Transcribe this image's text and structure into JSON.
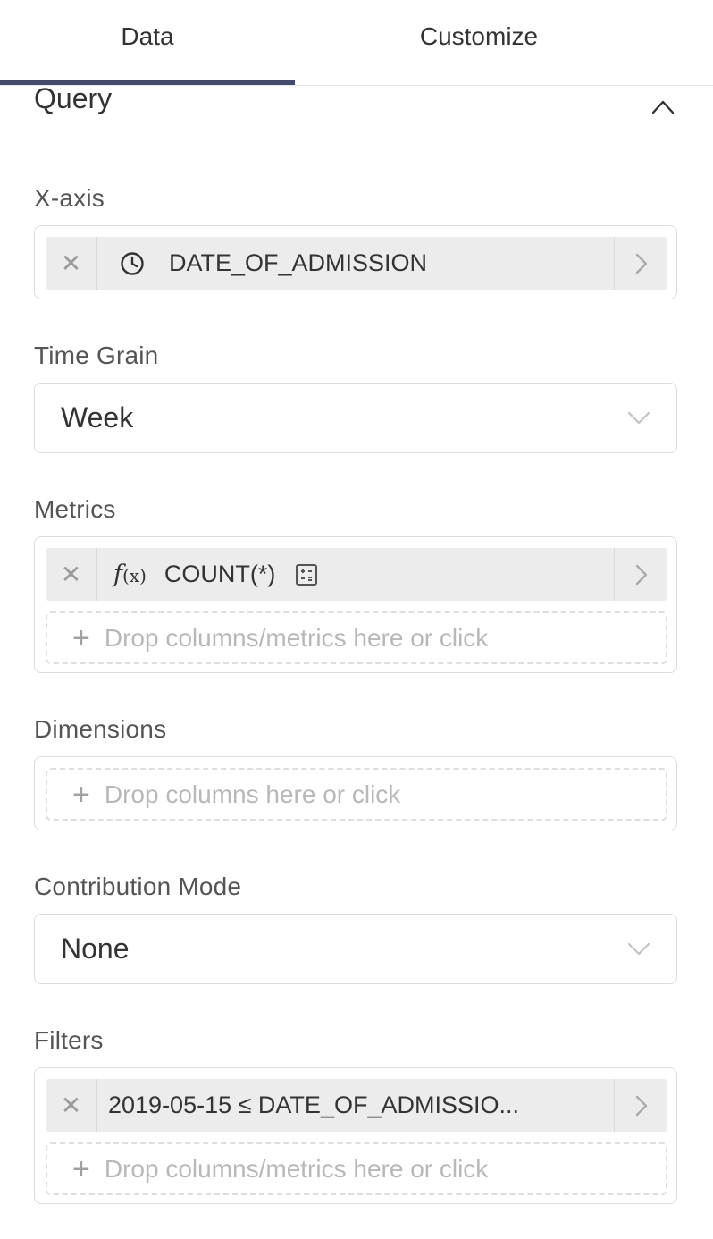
{
  "tabs": [
    {
      "label": "Data",
      "active": true
    },
    {
      "label": "Customize",
      "active": false
    }
  ],
  "query": {
    "title": "Query",
    "collapse_icon": "chevron-up-icon"
  },
  "xaxis": {
    "label": "X-axis",
    "value": "DATE_OF_ADMISSION",
    "icon": "clock-icon"
  },
  "time_grain": {
    "label": "Time Grain",
    "value": "Week"
  },
  "metrics": {
    "label": "Metrics",
    "fx_label": "f",
    "fx_sub": "(x)",
    "value": "COUNT(*)",
    "drop_placeholder": "Drop columns/metrics here or click"
  },
  "dimensions": {
    "label": "Dimensions",
    "drop_placeholder": "Drop columns here or click"
  },
  "contribution_mode": {
    "label": "Contribution Mode",
    "value": "None"
  },
  "filters": {
    "label": "Filters",
    "value": "2019-05-15 ≤ DATE_OF_ADMISSIO...",
    "drop_placeholder": "Drop columns/metrics here or click"
  },
  "colors": {
    "active_tab_underline": "#444c6e",
    "pill_bg": "#ececec",
    "border": "#dcdcdc"
  }
}
